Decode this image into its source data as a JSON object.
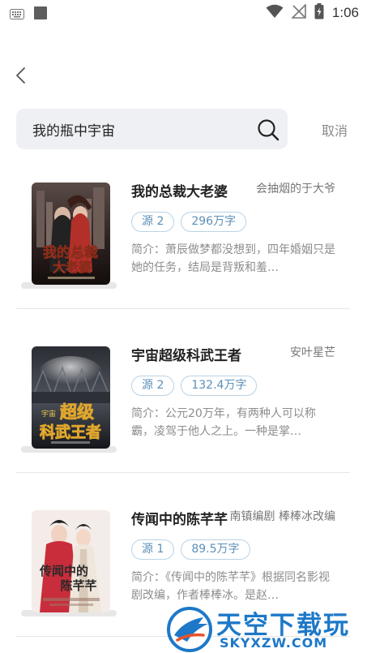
{
  "status_bar": {
    "time": "1:06"
  },
  "search": {
    "query": "我的瓶中宇宙",
    "cancel_label": "取消"
  },
  "results": [
    {
      "title": "我的总裁大老婆",
      "author": "会抽烟的于大爷",
      "source": "源 2",
      "word_count": "296万字",
      "description": "简介：萧辰做梦都没想到，四年婚姻只是她的任务，结局是背叛和羞…",
      "cover_text": "我的总裁大老婆",
      "cover_colors": [
        "#3a2c2a",
        "#c04234",
        "#f6d36a"
      ]
    },
    {
      "title": "宇宙超级科武王者",
      "author": "安叶星芒",
      "source": "源 2",
      "word_count": "132.4万字",
      "description": "简介：公元20万年，有两种人可以称霸，凌驾于他人之上。一种是掌…",
      "cover_text": "宇宙超级科武王者",
      "cover_colors": [
        "#1b1d22",
        "#5a5f68",
        "#f2c64a"
      ]
    },
    {
      "title": "传闻中的陈芊芊",
      "author": "南镇编剧 棒棒冰改编",
      "source": "源 1",
      "word_count": "89.5万字",
      "description": "简介：《传闻中的陈芊芊》根据同名影视剧改编，作者棒棒冰。是赵…",
      "cover_text": "传闻中的陈芊芊",
      "cover_colors": [
        "#f3ece8",
        "#c92d3b",
        "#2a2a2a"
      ]
    }
  ],
  "watermark": {
    "brand": "天空下载玩",
    "domain": "SKYXZW.COM"
  }
}
